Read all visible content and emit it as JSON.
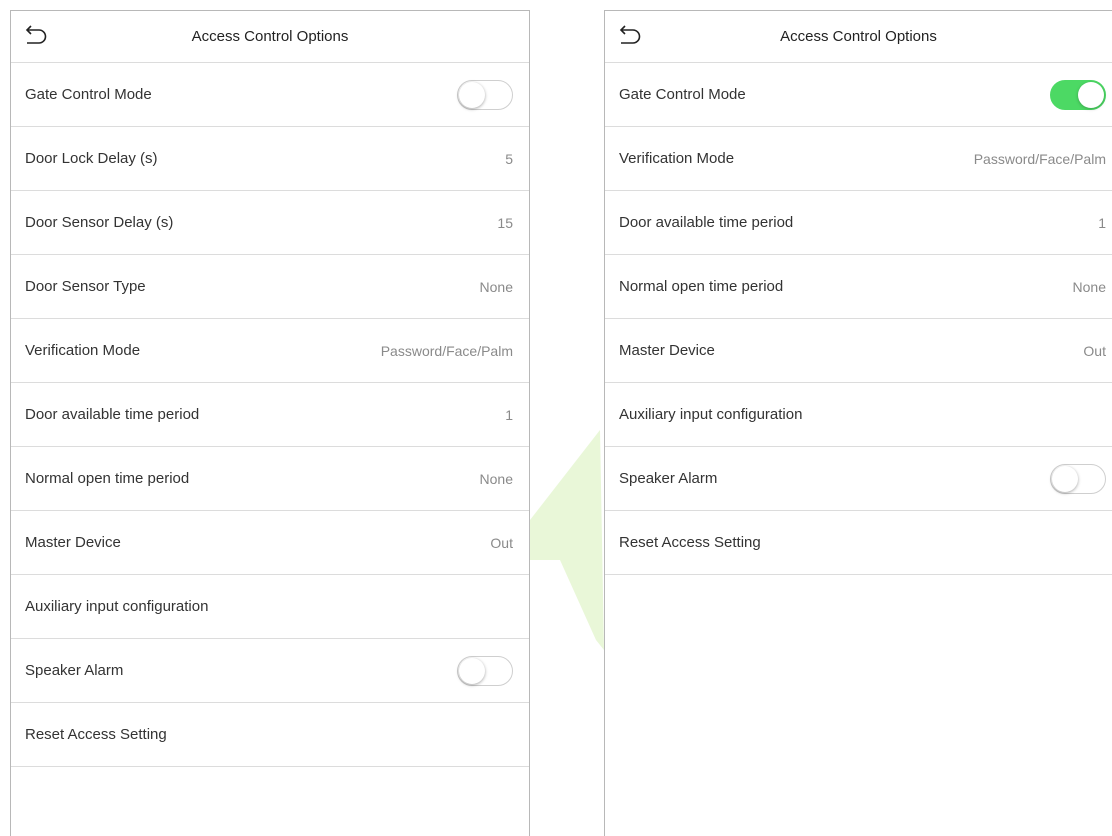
{
  "colors": {
    "toggle_on": "#4cd964",
    "divider": "#dcdcdc",
    "value_text": "#8a8a8a",
    "watermark": "#e9f7d8"
  },
  "left_screen": {
    "title": "Access Control Options",
    "back_icon": "back-arrow-icon",
    "rows": [
      {
        "label": "Gate Control Mode",
        "toggle": "off"
      },
      {
        "label": "Door Lock Delay (s)",
        "value": "5"
      },
      {
        "label": "Door Sensor Delay (s)",
        "value": "15"
      },
      {
        "label": "Door Sensor Type",
        "value": "None"
      },
      {
        "label": "Verification Mode",
        "value": "Password/Face/Palm"
      },
      {
        "label": "Door available time period",
        "value": "1"
      },
      {
        "label": "Normal open time period",
        "value": "None"
      },
      {
        "label": "Master Device",
        "value": "Out"
      },
      {
        "label": "Auxiliary input configuration"
      },
      {
        "label": "Speaker Alarm",
        "toggle": "off"
      },
      {
        "label": "Reset Access Setting"
      }
    ]
  },
  "right_screen": {
    "title": "Access Control Options",
    "back_icon": "back-arrow-icon",
    "rows": [
      {
        "label": "Gate Control Mode",
        "toggle": "on"
      },
      {
        "label": "Verification Mode",
        "value": "Password/Face/Palm"
      },
      {
        "label": "Door available time period",
        "value": "1"
      },
      {
        "label": "Normal open time period",
        "value": "None"
      },
      {
        "label": "Master Device",
        "value": "Out"
      },
      {
        "label": "Auxiliary input configuration"
      },
      {
        "label": "Speaker Alarm",
        "toggle": "off"
      },
      {
        "label": "Reset Access Setting"
      }
    ]
  }
}
